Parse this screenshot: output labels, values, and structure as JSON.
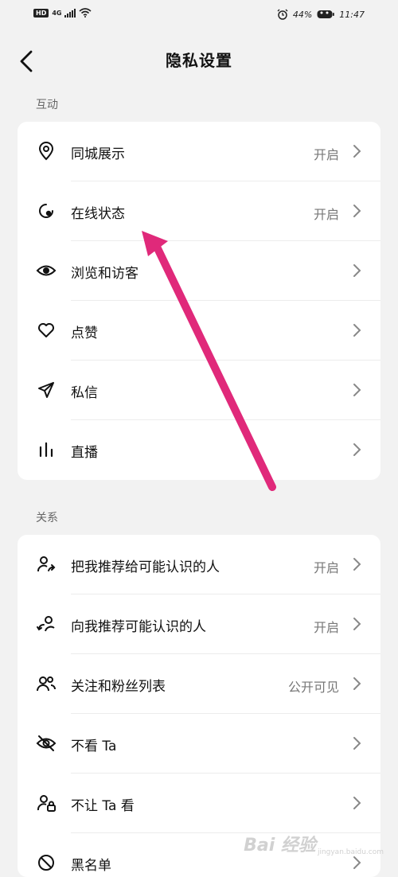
{
  "status_bar": {
    "hd": "HD",
    "network": "4G",
    "battery": "44%",
    "time": "11:47"
  },
  "header": {
    "title": "隐私设置"
  },
  "section_interact": {
    "label": "互动",
    "items": [
      {
        "label": "同城展示",
        "value": "开启",
        "icon": "location-pin-icon"
      },
      {
        "label": "在线状态",
        "value": "开启",
        "icon": "online-status-icon"
      },
      {
        "label": "浏览和访客",
        "value": "",
        "icon": "eye-icon"
      },
      {
        "label": "点赞",
        "value": "",
        "icon": "heart-icon"
      },
      {
        "label": "私信",
        "value": "",
        "icon": "send-icon"
      },
      {
        "label": "直播",
        "value": "",
        "icon": "bars-icon"
      }
    ]
  },
  "section_relation": {
    "label": "关系",
    "items": [
      {
        "label": "把我推荐给可能认识的人",
        "value": "开启",
        "icon": "user-share-icon"
      },
      {
        "label": "向我推荐可能认识的人",
        "value": "开启",
        "icon": "user-recommend-icon"
      },
      {
        "label": "关注和粉丝列表",
        "value": "公开可见",
        "icon": "users-icon"
      },
      {
        "label": "不看 Ta",
        "value": "",
        "icon": "eye-off-icon"
      },
      {
        "label": "不让 Ta 看",
        "value": "",
        "icon": "user-lock-icon"
      },
      {
        "label": "黑名单",
        "value": "",
        "icon": "block-icon"
      }
    ]
  },
  "watermark": {
    "text": "Bai 经验",
    "sub": "jingyan.baidu.com"
  },
  "colors": {
    "annotation_arrow": "#e0297a",
    "background": "#f2f2f2",
    "card": "#ffffff"
  }
}
